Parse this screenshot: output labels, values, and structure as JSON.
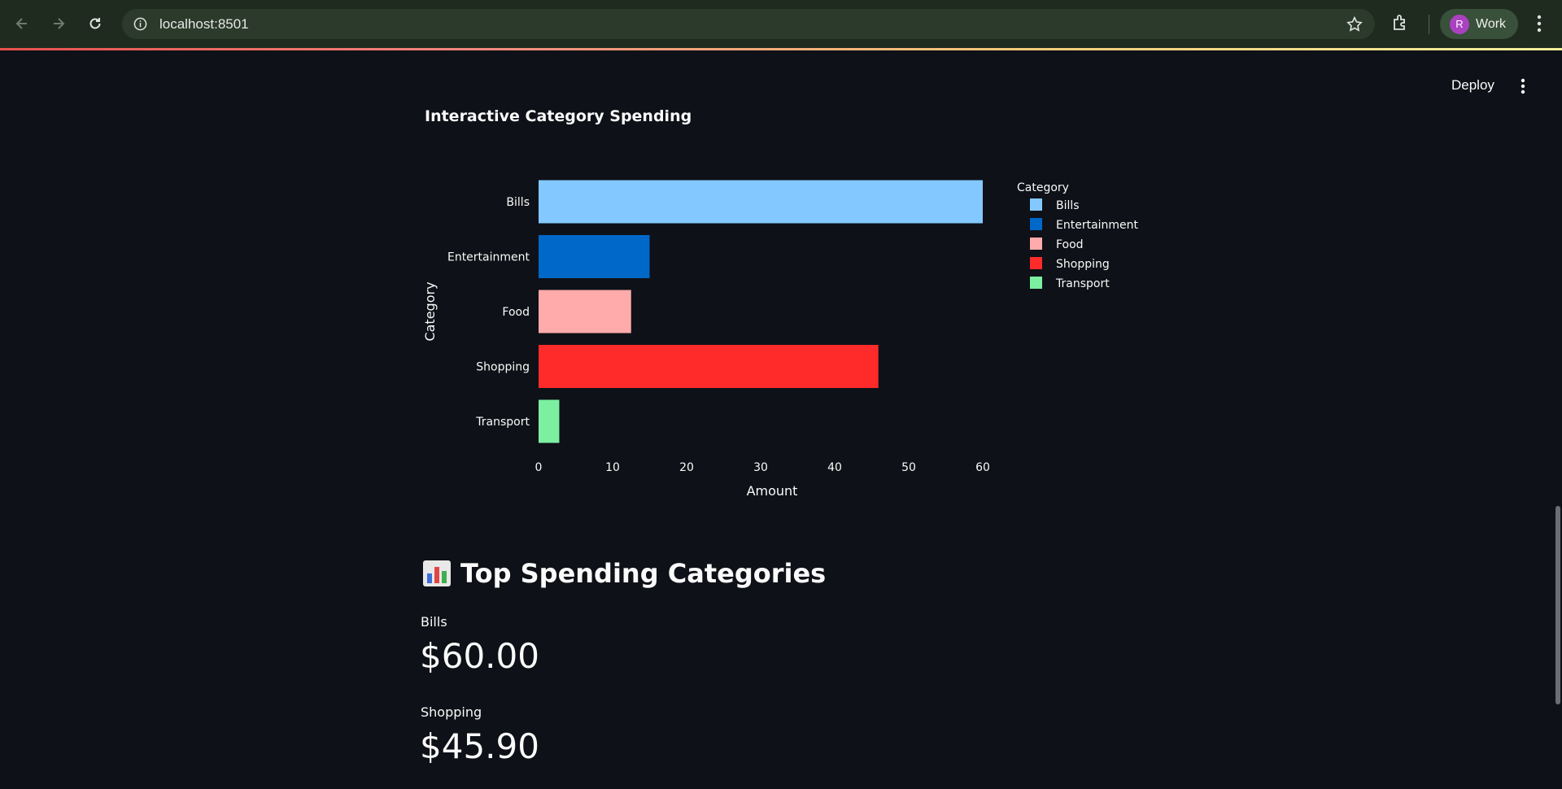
{
  "browser": {
    "url": "localhost:8501",
    "profile_initial": "R",
    "profile_name": "Work",
    "icons": [
      "back-arrow-icon",
      "forward-arrow-icon",
      "reload-icon",
      "info-icon",
      "star-icon",
      "extensions-icon",
      "kebab-menu-icon"
    ]
  },
  "header": {
    "deploy_label": "Deploy"
  },
  "chart": {
    "title": "Interactive Category Spending"
  },
  "chart_data": {
    "type": "bar",
    "orientation": "horizontal",
    "categories": [
      "Bills",
      "Entertainment",
      "Food",
      "Shopping",
      "Transport"
    ],
    "values": [
      60.0,
      15.0,
      12.5,
      45.9,
      2.8
    ],
    "colors": [
      "#83c9ff",
      "#0068c9",
      "#ffabab",
      "#ff2b2b",
      "#7defa1"
    ],
    "xlabel": "Amount",
    "ylabel": "Category",
    "xlim": [
      0,
      60
    ],
    "xticks": [
      0,
      10,
      20,
      30,
      40,
      50,
      60
    ],
    "legend_title": "Category",
    "legend_placement": "right",
    "grid": false
  },
  "metrics_section": {
    "heading": "Top Spending Categories",
    "items": [
      {
        "label": "Bills",
        "value": "$60.00"
      },
      {
        "label": "Shopping",
        "value": "$45.90"
      }
    ]
  }
}
